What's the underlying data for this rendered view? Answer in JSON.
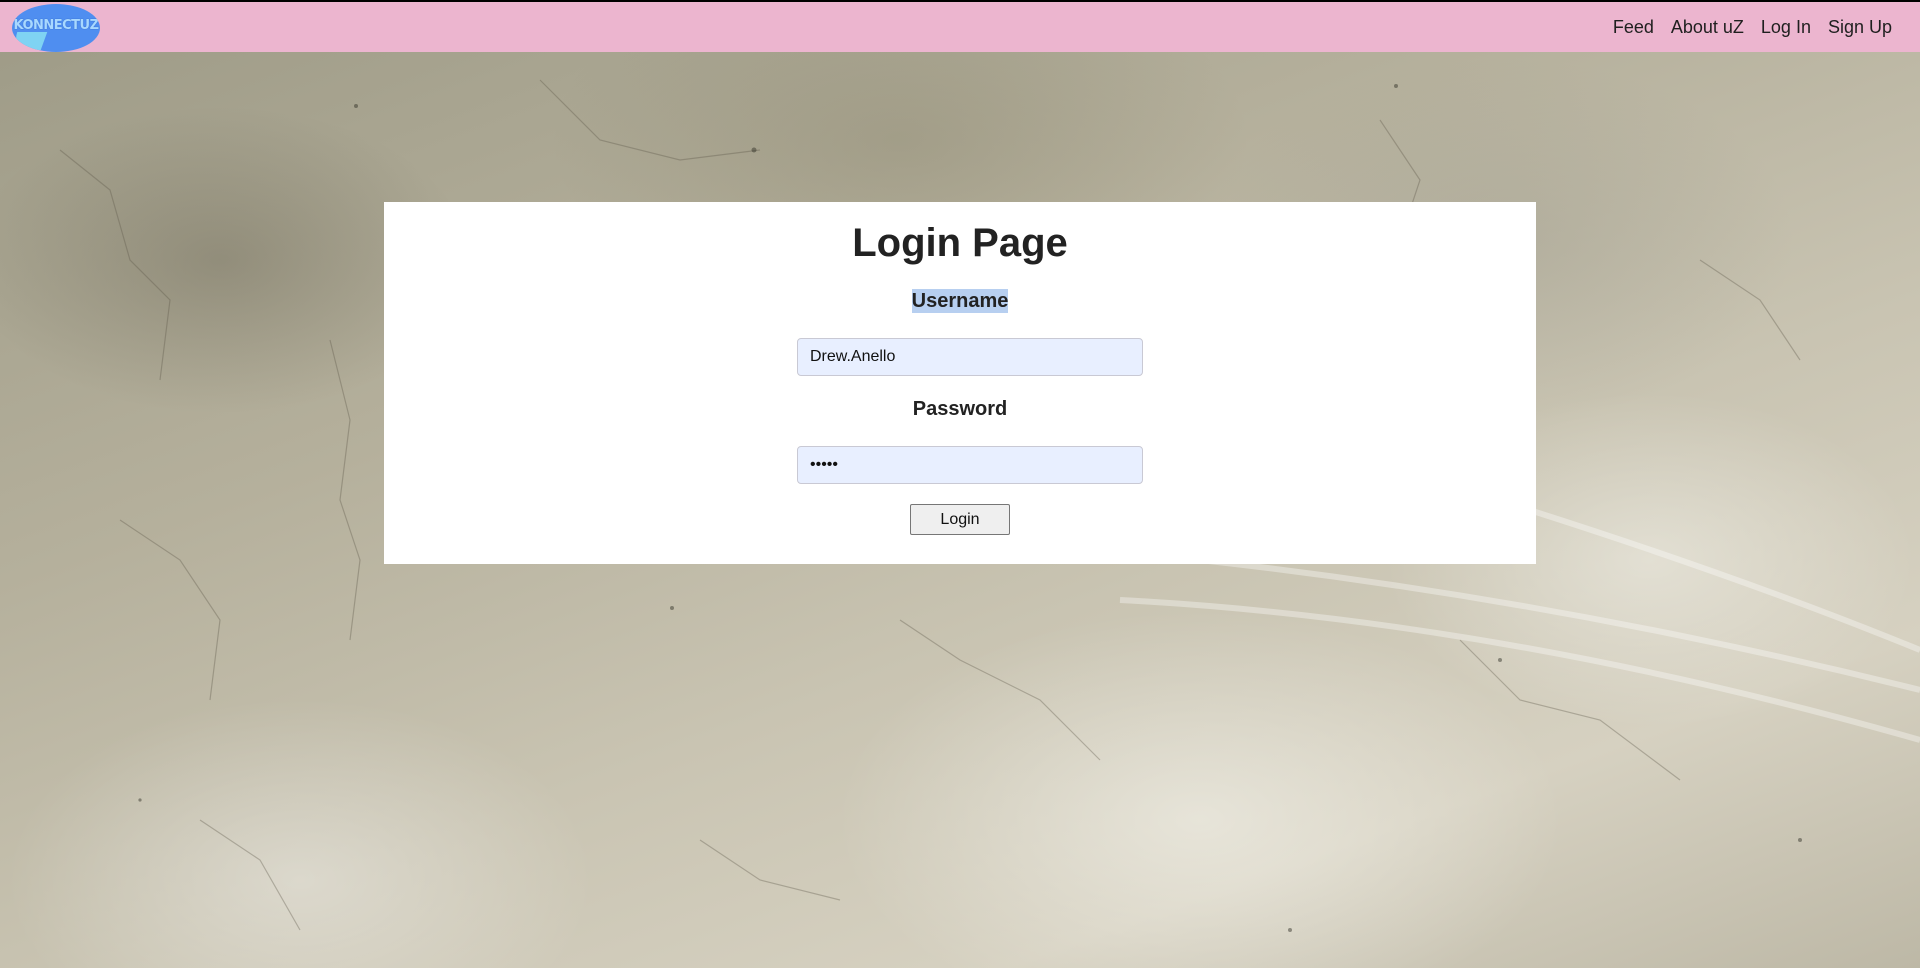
{
  "nav": {
    "logo_text": "KONNECTUZ",
    "links": [
      "Feed",
      "About uZ",
      "Log In",
      "Sign Up"
    ]
  },
  "login": {
    "title": "Login Page",
    "username_label": "Username",
    "username_value": "Drew.Anello",
    "password_label": "Password",
    "password_value": "•••••",
    "button_label": "Login"
  },
  "colors": {
    "navbar": "#ecb5cf",
    "logo": "#4f8ef0",
    "input_fill": "#e8efff",
    "selection": "#b7cff0"
  }
}
